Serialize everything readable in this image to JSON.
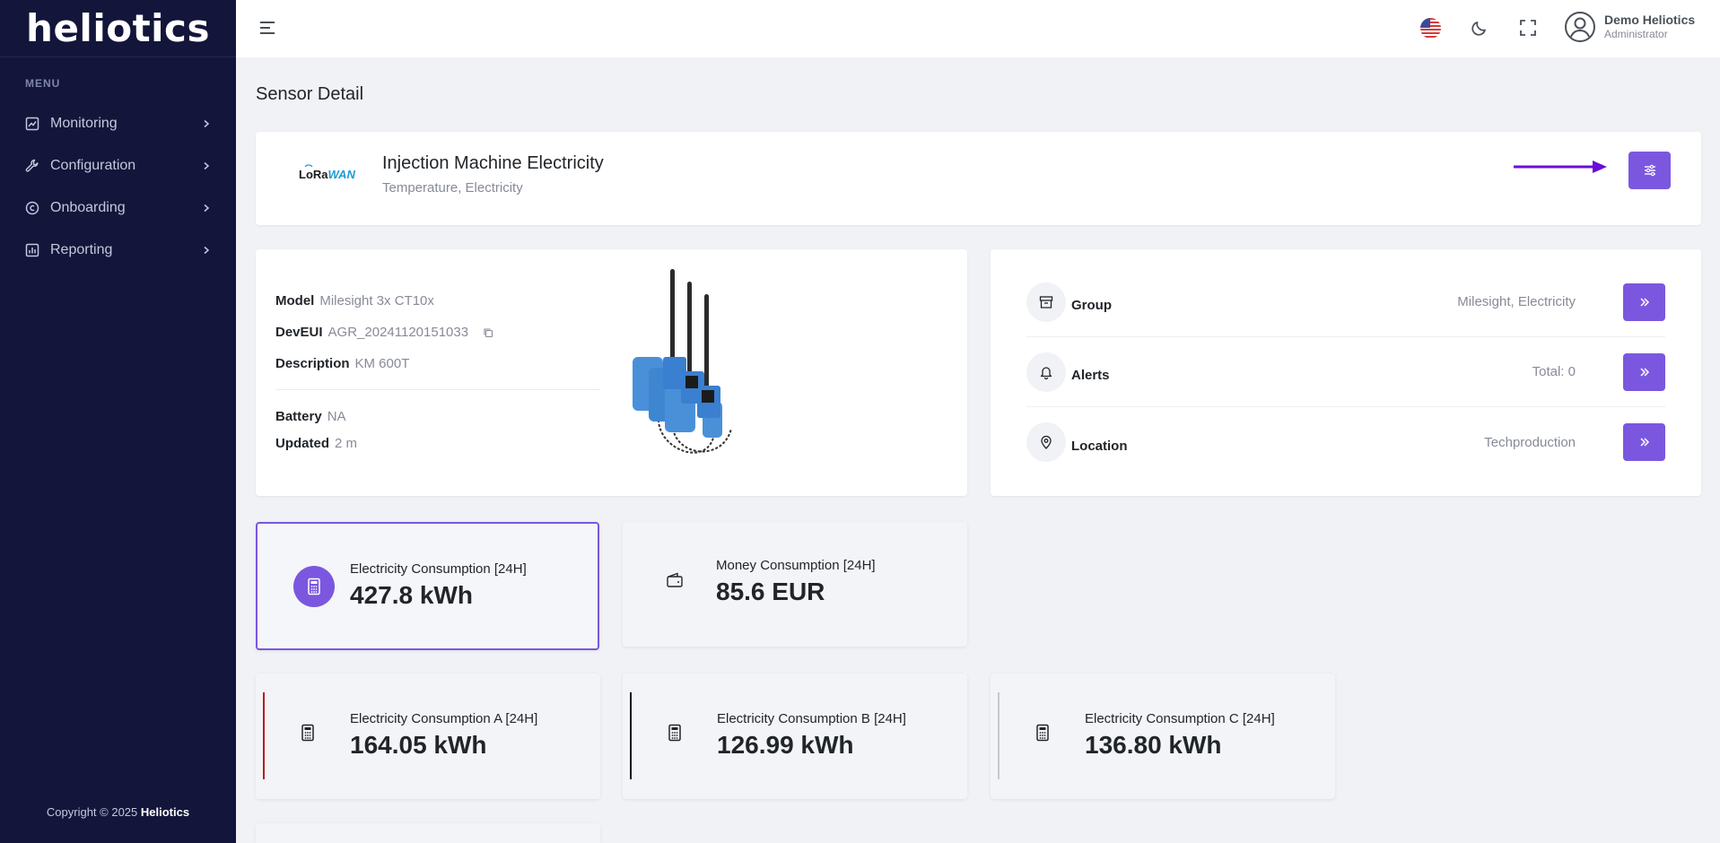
{
  "sidebar": {
    "logo": "heliotics",
    "menu_title": "MENU",
    "items": [
      {
        "label": "Monitoring",
        "icon": "chart-icon"
      },
      {
        "label": "Configuration",
        "icon": "wrench-icon"
      },
      {
        "label": "Onboarding",
        "icon": "copyright-circle-icon"
      },
      {
        "label": "Reporting",
        "icon": "bar-chart-icon"
      }
    ],
    "copyright_prefix": "Copyright © 2025 ",
    "copyright_brand": "Heliotics"
  },
  "topbar": {
    "user_name": "Demo Heliotics",
    "user_role": "Administrator",
    "language_icon": "us-flag-icon",
    "theme_icon": "moon-icon",
    "fullscreen_icon": "fullscreen-icon"
  },
  "page": {
    "title": "Sensor Detail"
  },
  "sensor": {
    "brand_logo_a": "LoRa",
    "brand_logo_b": "WAN",
    "name": "Injection Machine Electricity",
    "types": "Temperature, Electricity"
  },
  "info": {
    "model_label": "Model",
    "model_value": "Milesight 3x CT10x",
    "deveui_label": "DevEUI",
    "deveui_value": "AGR_20241120151033",
    "description_label": "Description",
    "description_value": "KM 600T",
    "battery_label": "Battery",
    "battery_value": "NA",
    "updated_label": "Updated",
    "updated_value": "2 m"
  },
  "relations": [
    {
      "label": "Group",
      "value": "Milesight, Electricity",
      "icon": "archive-icon"
    },
    {
      "label": "Alerts",
      "value": "Total: 0",
      "icon": "bell-icon"
    },
    {
      "label": "Location",
      "value": "Techproduction",
      "icon": "map-pin-icon"
    }
  ],
  "stats": {
    "electricity": {
      "label": "Electricity Consumption [24H]",
      "value": "427.8 kWh"
    },
    "money": {
      "label": "Money Consumption [24H]",
      "value": "85.6 EUR"
    },
    "phase_a": {
      "label": "Electricity Consumption A [24H]",
      "value": "164.05 kWh",
      "color": "#b71c1c"
    },
    "phase_b": {
      "label": "Electricity Consumption B [24H]",
      "value": "126.99 kWh",
      "color": "#111111"
    },
    "phase_c": {
      "label": "Electricity Consumption C [24H]",
      "value": "136.80 kWh",
      "color": "#c7c9d0"
    }
  },
  "colors": {
    "sidebar_bg": "#13163a",
    "accent": "#7b57e0",
    "annotation_arrow": "#6a0dd8"
  }
}
